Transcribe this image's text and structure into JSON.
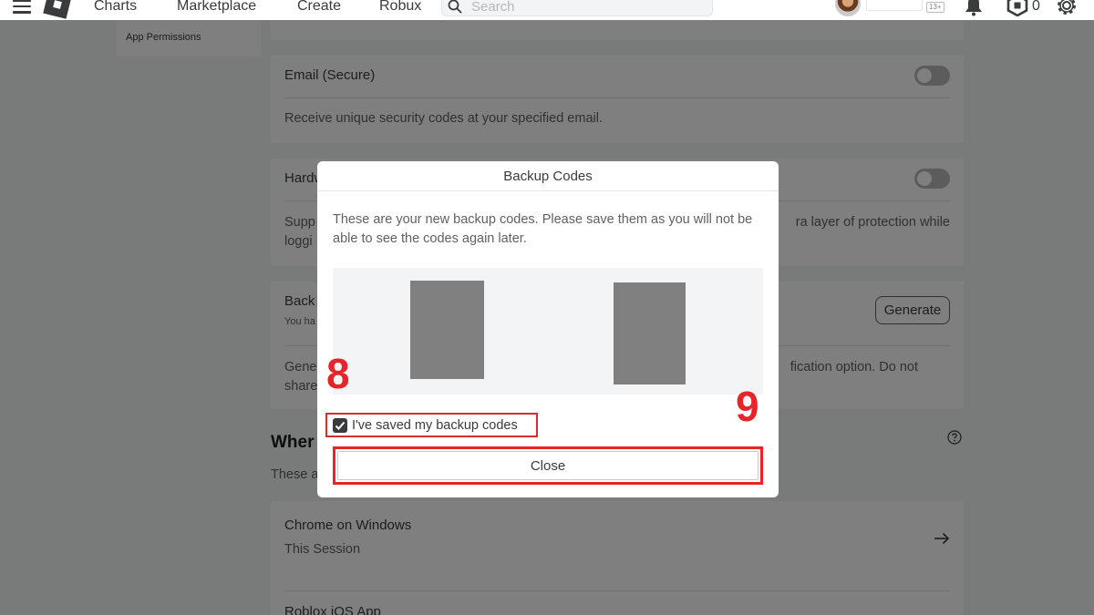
{
  "nav": {
    "links": [
      "Charts",
      "Marketplace",
      "Create",
      "Robux"
    ],
    "search_placeholder": "Search",
    "age_badge": "13+",
    "robux_count": "0"
  },
  "left_menu": {
    "item": "App Permissions"
  },
  "settings": {
    "email": {
      "title": "Email (Secure)",
      "description": "Receive unique security codes at your specified email.",
      "enabled": false
    },
    "hardware": {
      "title": "Hardw",
      "description_start": "Supp",
      "description_end": "ra layer of protection while",
      "description_line2": "loggi",
      "enabled": false
    },
    "backup": {
      "title": "Back",
      "subtitle": "You ha",
      "generate_label": "Generate",
      "description_start": "Gene",
      "description_end": "fication option. Do not",
      "description_line2": "share"
    }
  },
  "sessions": {
    "title": "Wher",
    "subtitle": "These a",
    "items": [
      {
        "name": "Chrome on Windows",
        "detail": "This Session"
      },
      {
        "name": "Roblox iOS App",
        "detail": ""
      }
    ]
  },
  "modal": {
    "title": "Backup Codes",
    "message": "These are your new backup codes. Please save them as you will not be able to see the codes again later.",
    "checkbox_label": "I've saved my backup codes",
    "checkbox_checked": true,
    "close_label": "Close"
  },
  "annotations": {
    "step_checkbox": "8",
    "step_close": "9",
    "highlight_color": "#e8232a"
  }
}
